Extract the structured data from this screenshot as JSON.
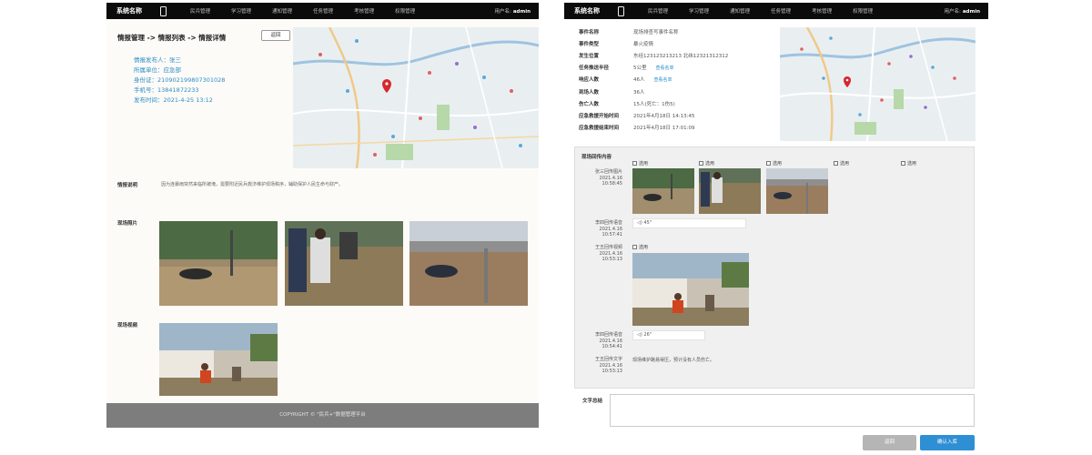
{
  "left": {
    "topbar": {
      "brand": "系统名称",
      "nav": [
        "民兵管理",
        "学习管理",
        "通知管理",
        "任务管理",
        "考核管理",
        "权限管理"
      ],
      "user_label": "用户名:",
      "user_name": "admin"
    },
    "breadcrumb": "情报管理 -> 情报列表 -> 情报详情",
    "back_label": "返回",
    "reporter": {
      "name": "情报发布人：张三",
      "unit": "所属单位：应急部",
      "id_card": "身份证：210902199807301028",
      "phone": "手机号：13841872233",
      "time": "发布时间：2021-4-25 13:12"
    },
    "desc_label": "情报说明",
    "desc_text": "因为连暴雨突然来临所被淹，需要附近民兵救济维护现场秩序，辅助保护人民生命与财产。",
    "photos_label": "现场照片",
    "video_label": "现场视频",
    "footer": "COPYRIGHT © \"民兵+\"数据管理平台"
  },
  "right": {
    "topbar": {
      "brand": "系统名称",
      "nav": [
        "民兵管理",
        "学习管理",
        "通知管理",
        "任务管理",
        "考核管理",
        "权限管理"
      ],
      "user_label": "用户名:",
      "user_name": "admin"
    },
    "info": [
      {
        "k": "事件名称",
        "v": "现场排查写事件名称",
        "link": ""
      },
      {
        "k": "事件类型",
        "v": "暴火疫情",
        "link": ""
      },
      {
        "k": "发生位置",
        "v": "东经123123213213  北纬12321312312",
        "link": ""
      },
      {
        "k": "任务推送半径",
        "v": "5公里",
        "link": "查看名单"
      },
      {
        "k": "响应人数",
        "v": "46人",
        "link": "查看名单"
      },
      {
        "k": "到场人数",
        "v": "36人",
        "link": ""
      },
      {
        "k": "伤亡人数",
        "v": "15人(死亡：1伤5)",
        "link": ""
      },
      {
        "k": "应急救援开始时间",
        "v": "2021年4月18日  14:13:45",
        "link": ""
      },
      {
        "k": "应急救援结束时间",
        "v": "2021年4月18日  17:01:09",
        "link": ""
      }
    ],
    "content_title": "现场回传内容",
    "use_label": "选用",
    "entries": [
      {
        "who": "张三回传图片",
        "date": "2021.4.16",
        "time": "10:58:45"
      },
      {
        "who": "李四回传语音",
        "date": "2021.4.16",
        "time": "10:57:41",
        "audio": "45\""
      },
      {
        "who": "王五回传视频",
        "date": "2021.4.16",
        "time": "10:53:13"
      },
      {
        "who": "李四回传语音",
        "date": "2021.4.16",
        "time": "10:54:41",
        "audio": "26\""
      },
      {
        "who": "王五回传文字",
        "date": "2021.4.16",
        "time": "10:53:13",
        "text": "现场维护路易得压，预计没有人员伤亡。"
      }
    ],
    "summary_label": "文字总结",
    "back_btn": "返回",
    "confirm_btn": "确认入库"
  }
}
